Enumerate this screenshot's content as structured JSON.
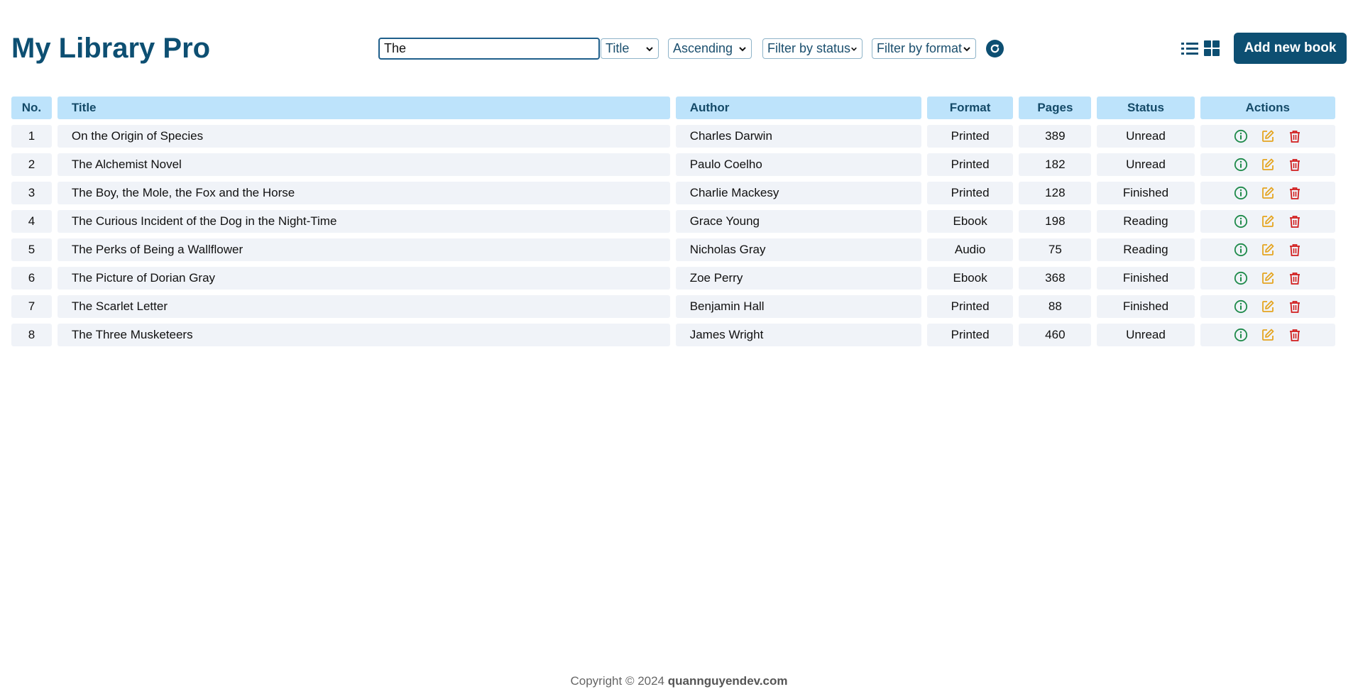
{
  "app": {
    "title": "My Library Pro"
  },
  "toolbar": {
    "search_value": "The",
    "sort_field": "Title",
    "sort_order": "Ascending",
    "status_filter": "Filter by status",
    "format_filter": "Filter by format",
    "add_button": "Add new book",
    "refresh_icon": "refresh-icon",
    "list_view_icon": "list-view-icon",
    "grid_view_icon": "grid-view-icon"
  },
  "table": {
    "headers": {
      "no": "No.",
      "title": "Title",
      "author": "Author",
      "format": "Format",
      "pages": "Pages",
      "status": "Status",
      "actions": "Actions"
    },
    "rows": [
      {
        "no": "1",
        "title": "On the Origin of Species",
        "author": "Charles Darwin",
        "format": "Printed",
        "pages": "389",
        "status": "Unread"
      },
      {
        "no": "2",
        "title": "The Alchemist Novel",
        "author": "Paulo Coelho",
        "format": "Printed",
        "pages": "182",
        "status": "Unread"
      },
      {
        "no": "3",
        "title": "The Boy, the Mole, the Fox and the Horse",
        "author": "Charlie Mackesy",
        "format": "Printed",
        "pages": "128",
        "status": "Finished"
      },
      {
        "no": "4",
        "title": "The Curious Incident of the Dog in the Night-Time",
        "author": "Grace Young",
        "format": "Ebook",
        "pages": "198",
        "status": "Reading"
      },
      {
        "no": "5",
        "title": "The Perks of Being a Wallflower",
        "author": "Nicholas Gray",
        "format": "Audio",
        "pages": "75",
        "status": "Reading"
      },
      {
        "no": "6",
        "title": "The Picture of Dorian Gray",
        "author": "Zoe Perry",
        "format": "Ebook",
        "pages": "368",
        "status": "Finished"
      },
      {
        "no": "7",
        "title": "The Scarlet Letter",
        "author": "Benjamin Hall",
        "format": "Printed",
        "pages": "88",
        "status": "Finished"
      },
      {
        "no": "8",
        "title": "The Three Musketeers",
        "author": "James Wright",
        "format": "Printed",
        "pages": "460",
        "status": "Unread"
      }
    ],
    "action_icons": [
      "info-icon",
      "edit-icon",
      "trash-icon"
    ]
  },
  "footer": {
    "copyright": "Copyright © 2024 ",
    "site": "quannguyendev.com"
  },
  "colors": {
    "brand": "#0d4f72",
    "header_bg": "#bde3fb",
    "row_bg": "#f0f3f8",
    "info": "#1e8a4a",
    "edit": "#e5a520",
    "delete": "#d11e1e"
  }
}
